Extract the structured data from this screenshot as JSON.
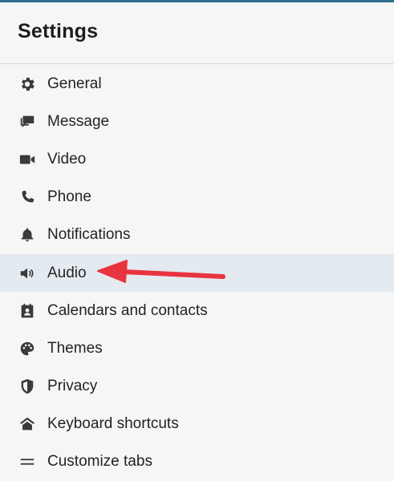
{
  "header": {
    "title": "Settings"
  },
  "menu": {
    "items": [
      {
        "label": "General",
        "icon": "gear-icon"
      },
      {
        "label": "Message",
        "icon": "chat-icon"
      },
      {
        "label": "Video",
        "icon": "video-camera-icon"
      },
      {
        "label": "Phone",
        "icon": "phone-icon"
      },
      {
        "label": "Notifications",
        "icon": "bell-icon"
      },
      {
        "label": "Audio",
        "icon": "speaker-icon"
      },
      {
        "label": "Calendars and contacts",
        "icon": "calendar-contact-icon"
      },
      {
        "label": "Themes",
        "icon": "palette-icon"
      },
      {
        "label": "Privacy",
        "icon": "shield-icon"
      },
      {
        "label": "Keyboard shortcuts",
        "icon": "keyboard-shortcut-icon"
      },
      {
        "label": "Customize tabs",
        "icon": "menu-lines-icon"
      }
    ],
    "selected": "Audio"
  },
  "colors": {
    "selected_background": "#e3eaf0",
    "annotation_arrow": "#e8343f",
    "icon": "#3a3a3a"
  }
}
